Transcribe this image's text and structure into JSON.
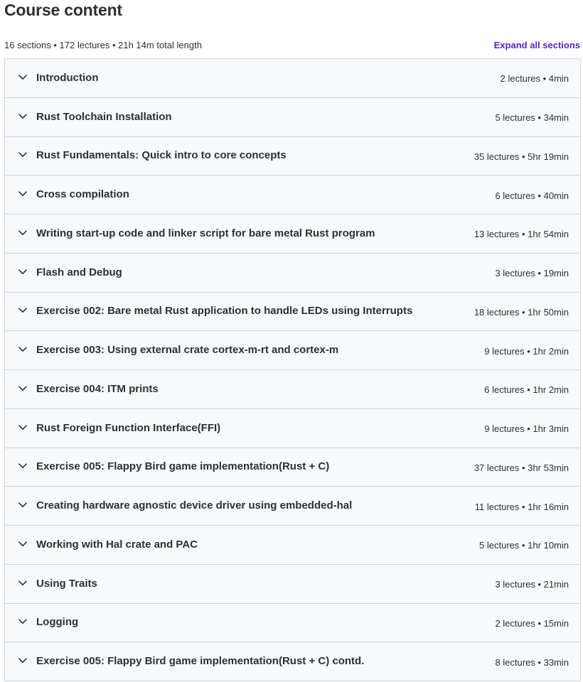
{
  "header": {
    "title": "Course content",
    "summary": "16 sections • 172 lectures • 21h 14m total length",
    "expand_label": "Expand all sections"
  },
  "icons": {
    "section_toggle": "chevron-down-icon"
  },
  "colors": {
    "accent": "#5624d0",
    "section_bg": "#f7f9fa",
    "border": "#d1d7dc",
    "text": "#2d2f31"
  },
  "sections": [
    {
      "title": "Introduction",
      "meta": "2 lectures • 4min"
    },
    {
      "title": "Rust Toolchain Installation",
      "meta": "5 lectures • 34min"
    },
    {
      "title": "Rust Fundamentals: Quick intro to core concepts",
      "meta": "35 lectures • 5hr 19min"
    },
    {
      "title": "Cross compilation",
      "meta": "6 lectures • 40min"
    },
    {
      "title": "Writing start-up code and linker script for bare metal Rust program",
      "meta": "13 lectures • 1hr 54min"
    },
    {
      "title": "Flash and Debug",
      "meta": "3 lectures • 19min"
    },
    {
      "title": "Exercise 002: Bare metal Rust application to handle LEDs using Interrupts",
      "meta": "18 lectures • 1hr 50min"
    },
    {
      "title": "Exercise 003: Using external crate cortex-m-rt and cortex-m",
      "meta": "9 lectures • 1hr 2min"
    },
    {
      "title": "Exercise 004: ITM prints",
      "meta": "6 lectures • 1hr 2min"
    },
    {
      "title": "Rust Foreign Function Interface(FFI)",
      "meta": "9 lectures • 1hr 3min"
    },
    {
      "title": "Exercise 005: Flappy Bird game implementation(Rust + C)",
      "meta": "37 lectures • 3hr 53min"
    },
    {
      "title": "Creating hardware agnostic device driver using embedded-hal",
      "meta": "11 lectures • 1hr 16min"
    },
    {
      "title": "Working with Hal crate and PAC",
      "meta": "5 lectures • 1hr 10min"
    },
    {
      "title": "Using Traits",
      "meta": "3 lectures • 21min"
    },
    {
      "title": "Logging",
      "meta": "2 lectures • 15min"
    },
    {
      "title": "Exercise 005: Flappy Bird game implementation(Rust + C) contd.",
      "meta": "8 lectures • 33min"
    }
  ]
}
